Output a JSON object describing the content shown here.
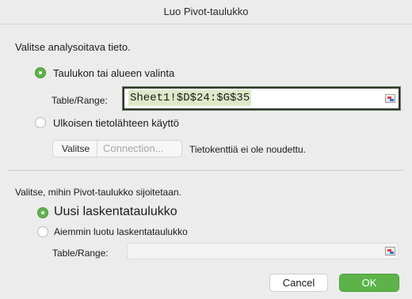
{
  "dialog": {
    "title": "Luo Pivot-taulukko"
  },
  "source_section": {
    "heading": "Valitse analysoitava tieto.",
    "option_table": {
      "label": "Taulukon tai alueen valinta",
      "selected": true
    },
    "table_range_label": "Table/Range:",
    "table_range_value": "Sheet1!$D$24:$G$35",
    "option_external": {
      "label": "Ulkoisen tietolähteen käyttö",
      "selected": false
    },
    "choose_button": "Valitse",
    "connection_button": "Connection...",
    "no_fields_text": "Tietokenttiä ei ole noudettu."
  },
  "destination_section": {
    "heading": "Valitse, mihin Pivot-taulukko sijoitetaan.",
    "option_new": {
      "label": "Uusi laskentataulukko",
      "selected": true
    },
    "option_existing": {
      "label": "Aiemmin luotu laskentataulukko",
      "selected": false
    },
    "table_range_label": "Table/Range:",
    "table_range_value": ""
  },
  "buttons": {
    "cancel": "Cancel",
    "ok": "OK"
  },
  "colors": {
    "accent_green": "#5db34a",
    "range_highlight": "#dfe9c9"
  }
}
